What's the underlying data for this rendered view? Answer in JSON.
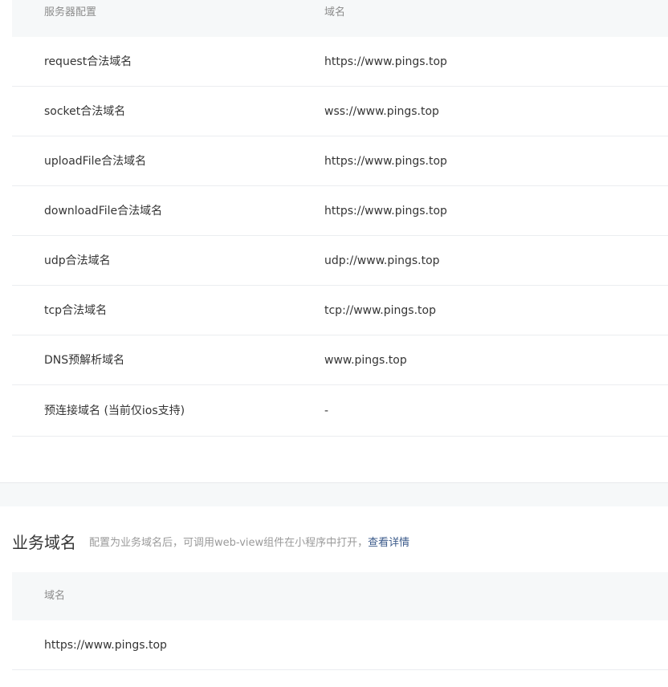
{
  "server_config": {
    "headers": {
      "config": "服务器配置",
      "domain": "域名"
    },
    "rows": [
      {
        "name": "request合法域名",
        "value": "https://www.pings.top"
      },
      {
        "name": "socket合法域名",
        "value": "wss://www.pings.top"
      },
      {
        "name": "uploadFile合法域名",
        "value": "https://www.pings.top"
      },
      {
        "name": "downloadFile合法域名",
        "value": "https://www.pings.top"
      },
      {
        "name": "udp合法域名",
        "value": "udp://www.pings.top"
      },
      {
        "name": "tcp合法域名",
        "value": "tcp://www.pings.top"
      },
      {
        "name": "DNS预解析域名",
        "value": "www.pings.top"
      },
      {
        "name": "预连接域名 (当前仅ios支持)",
        "value": "-"
      }
    ]
  },
  "business_domain": {
    "title": "业务域名",
    "description": "配置为业务域名后，可调用web-view组件在小程序中打开，",
    "link_label": "查看详情",
    "header": "域名",
    "rows": [
      {
        "value": "https://www.pings.top"
      }
    ]
  },
  "colors": {
    "header_bg": "#f6f8f9",
    "link": "#3c5b8b",
    "border": "#ebedf0"
  }
}
